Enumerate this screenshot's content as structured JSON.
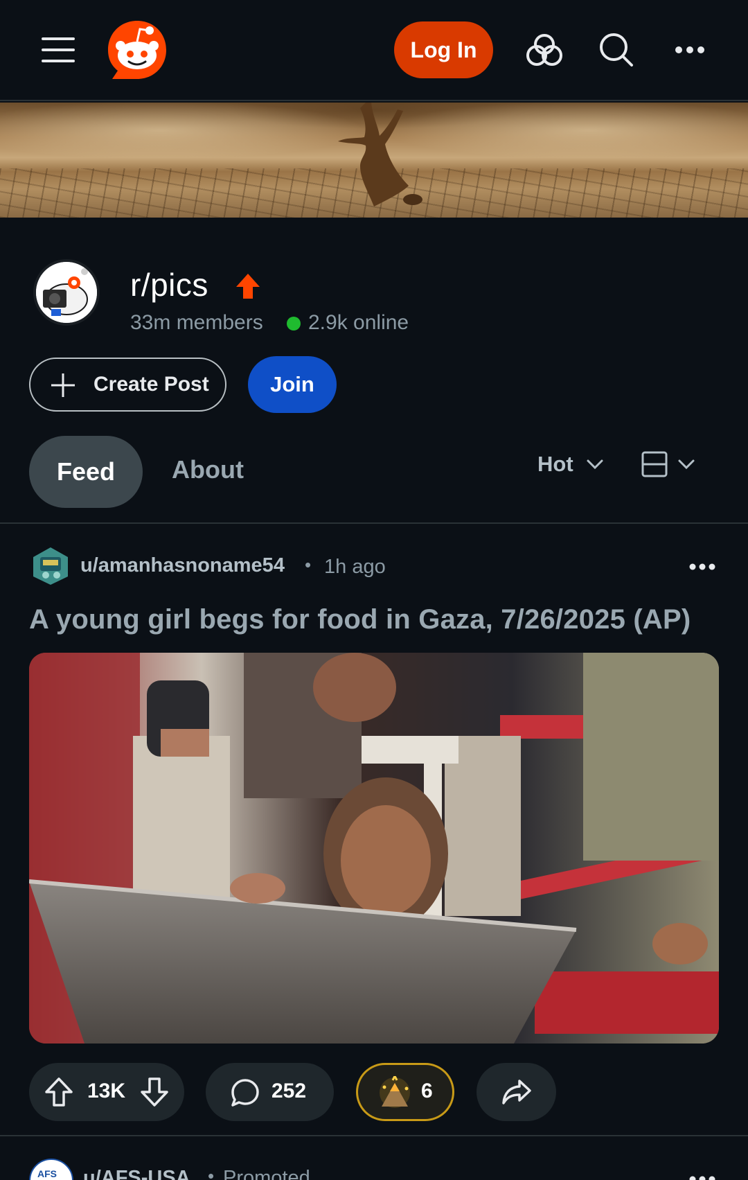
{
  "header": {
    "login_label": "Log In",
    "icons": [
      "hamburger-menu-icon",
      "reddit-logo",
      "games-icon",
      "search-icon",
      "more-horizontal-icon"
    ],
    "accent_color": "#d93a00"
  },
  "community": {
    "name": "r/pics",
    "members": "33m members",
    "online": "2.9k online",
    "online_color": "#1fbb2f",
    "create_post_label": "Create Post",
    "join_label": "Join",
    "join_color": "#0f4fc7"
  },
  "tabs": [
    {
      "label": "Feed",
      "active": true
    },
    {
      "label": "About",
      "active": false
    }
  ],
  "sort": {
    "label": "Hot"
  },
  "post": {
    "author": "u/amanhasnoname54",
    "separator": "•",
    "time": "1h ago",
    "title": "A young girl begs for food in Gaza, 7/26/2025 (AP)",
    "votes": "13K",
    "comments": "252",
    "awards": "6"
  },
  "next_post": {
    "author": "u/AFS-USA",
    "separator": "•",
    "label": "Promoted",
    "avatar_text": "AFS"
  }
}
